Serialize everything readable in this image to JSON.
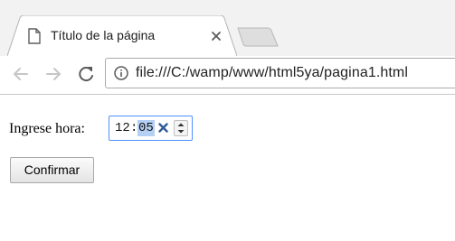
{
  "browser": {
    "tab": {
      "title": "Título de la página",
      "icon": "page-icon"
    },
    "address_bar": {
      "url": "file:///C:/wamp/www/html5ya/pagina1.html",
      "security_icon": "info-icon"
    },
    "nav_icons": [
      "back-arrow-icon",
      "forward-arrow-icon",
      "reload-icon"
    ]
  },
  "page": {
    "time_field": {
      "label": "Ingrese hora:",
      "hour": "12",
      "separator": ":",
      "minute": "05",
      "selected_segment": "minute"
    },
    "submit": {
      "label": "Confirmar"
    }
  },
  "colors": {
    "tab_strip_bg": "#f2f2f2",
    "focus_border": "#4d90fe",
    "selection_bg": "#b4d0f5",
    "clear_x": "#2f5b94"
  }
}
